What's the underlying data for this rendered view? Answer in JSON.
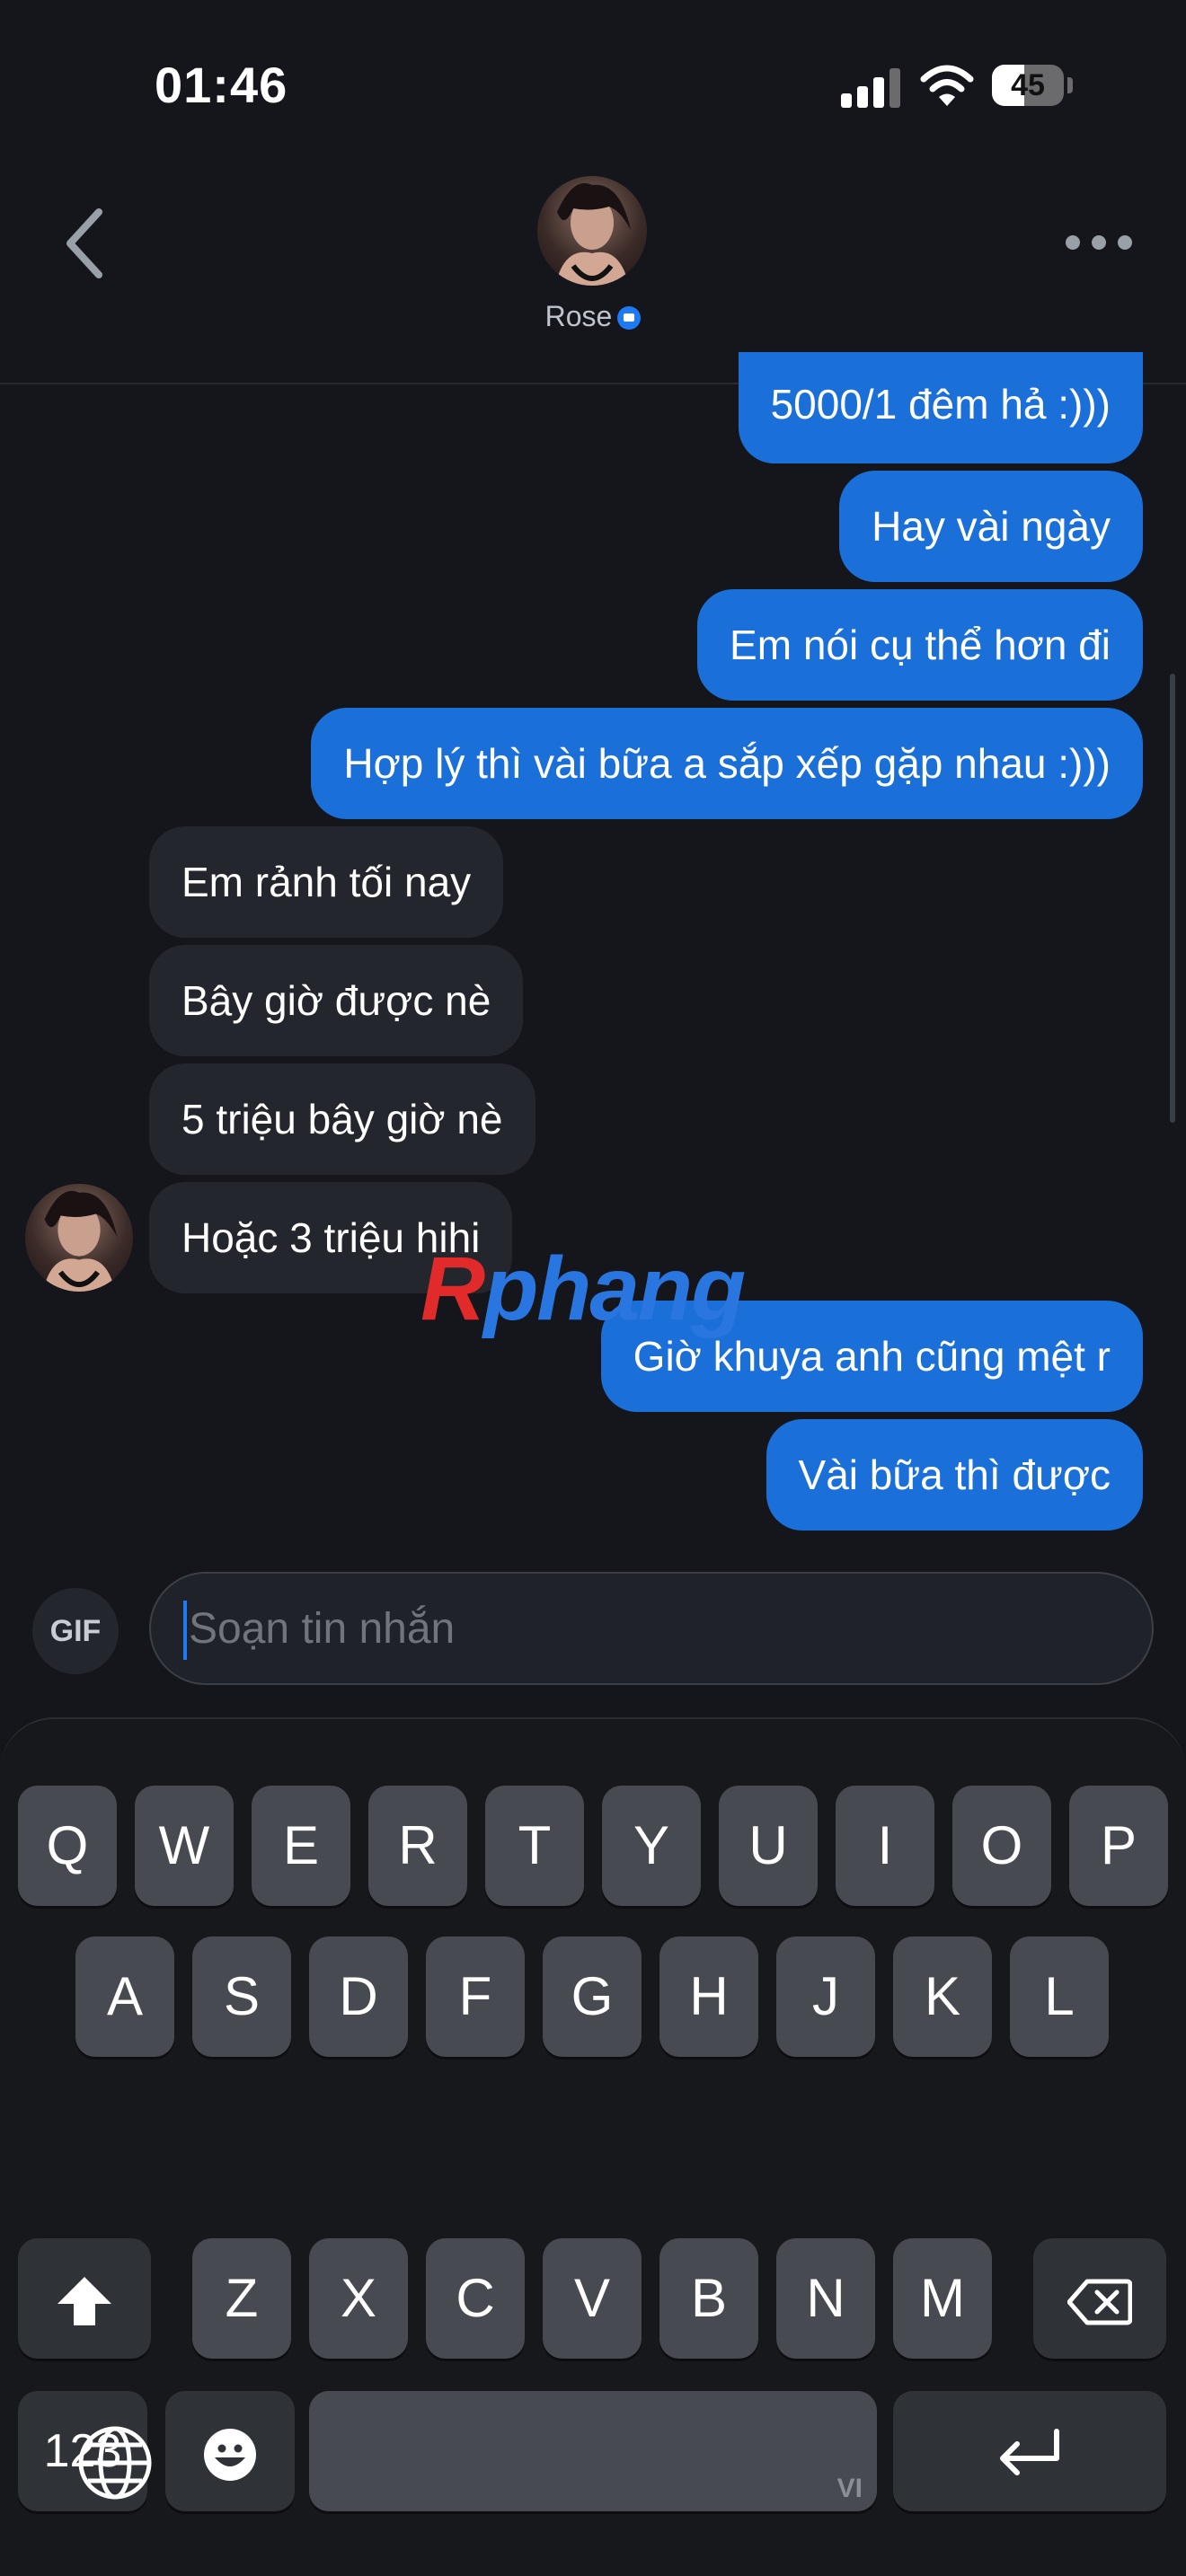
{
  "status_bar": {
    "time": "01:46",
    "battery": "45",
    "battery_level": 0.45
  },
  "header": {
    "contact_name": "Rose"
  },
  "messages": [
    {
      "text": "5000/1 đêm hả :)))",
      "direction": "outgoing"
    },
    {
      "text": "Hay vài ngày",
      "direction": "outgoing"
    },
    {
      "text": "Em nói cụ thể hơn đi",
      "direction": "outgoing"
    },
    {
      "text": "Hợp lý thì vài bữa a sắp xếp gặp nhau :)))",
      "direction": "outgoing"
    },
    {
      "text": "Em rảnh tối nay",
      "direction": "incoming"
    },
    {
      "text": "Bây giờ được nè",
      "direction": "incoming"
    },
    {
      "text": "5 triệu bây giờ nè",
      "direction": "incoming"
    },
    {
      "text": "Hoặc 3 triệu hihi",
      "direction": "incoming"
    },
    {
      "text": "Giờ khuya anh cũng mệt r",
      "direction": "outgoing"
    },
    {
      "text": "Vài bữa thì được",
      "direction": "outgoing"
    }
  ],
  "watermark": {
    "part1": "R",
    "part2": "phang"
  },
  "composer": {
    "gif_label": "GIF",
    "placeholder": "Soạn tin nhắn"
  },
  "keyboard": {
    "row1": [
      "Q",
      "W",
      "E",
      "R",
      "T",
      "Y",
      "U",
      "I",
      "O",
      "P"
    ],
    "row2": [
      "A",
      "S",
      "D",
      "F",
      "G",
      "H",
      "J",
      "K",
      "L"
    ],
    "row3": [
      "Z",
      "X",
      "C",
      "V",
      "B",
      "N",
      "M"
    ],
    "numbers_label": "123",
    "space_language": "VI"
  },
  "colors": {
    "outgoing_bubble": "#1b6fd8",
    "incoming_bubble": "#23262d",
    "background": "#14161b",
    "accent": "#1d7af2"
  },
  "icons": [
    "back-chevron-icon",
    "more-dots-icon",
    "camera-badge-icon",
    "signal-icon",
    "wifi-icon",
    "battery-icon",
    "shift-icon",
    "backspace-icon",
    "emoji-icon",
    "return-icon",
    "globe-icon"
  ]
}
